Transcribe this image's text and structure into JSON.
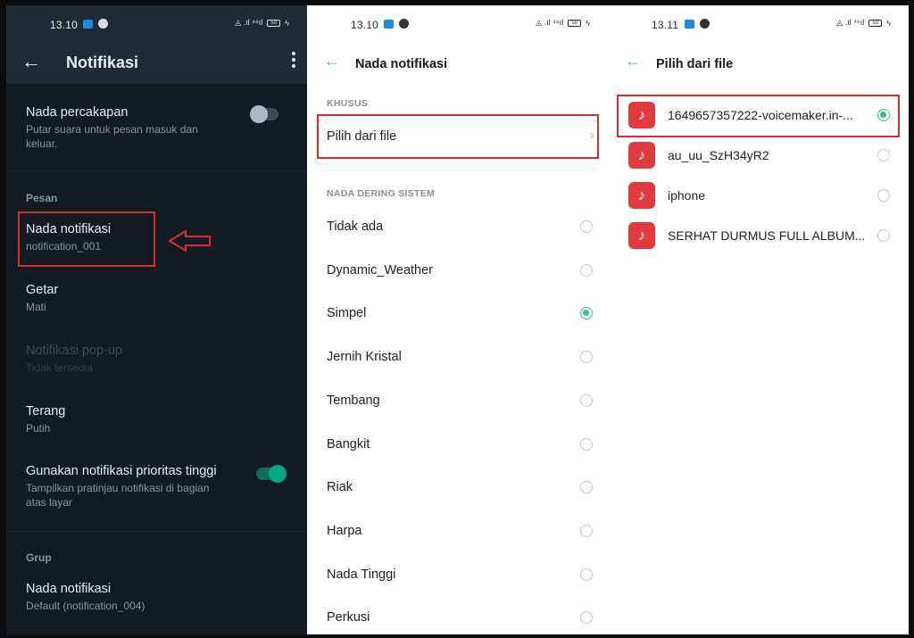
{
  "annotation_color": "#d32f2f",
  "accent": {
    "whatsapp_green": "#00a884",
    "radio_green": "#3bbf8a",
    "file_icon_red": "#e0393e"
  },
  "screens": [
    {
      "theme": "dark",
      "status_bar": {
        "time": "13.10",
        "battery": "50"
      },
      "app_bar": {
        "back_icon": "arrow-left",
        "title": "Notifikasi",
        "menu_icon": "more-vertical"
      },
      "items": [
        {
          "title": "Nada percakapan",
          "subtitle_line1": "Putar suara untuk pesan masuk dan",
          "subtitle_line2": "keluar.",
          "toggle": false
        },
        {
          "section": "Pesan"
        },
        {
          "title": "Nada notifikasi",
          "subtitle": "notification_001",
          "highlighted": true
        },
        {
          "title": "Getar",
          "subtitle": "Mati"
        },
        {
          "title": "Notifikasi pop-up",
          "subtitle": "Tidak tersedia",
          "disabled": true
        },
        {
          "title": "Terang",
          "subtitle": "Putih"
        },
        {
          "title": "Gunakan notifikasi prioritas tinggi",
          "subtitle_line1": "Tampilkan pratinjau notifikasi di bagian",
          "subtitle_line2": "atas layar",
          "toggle": true
        },
        {
          "section": "Grup"
        },
        {
          "title": "Nada notifikasi",
          "subtitle": "Default (notification_004)"
        }
      ]
    },
    {
      "theme": "light",
      "status_bar": {
        "time": "13.10",
        "battery": "50"
      },
      "app_bar": {
        "back_icon": "arrow-left",
        "title": "Nada notifikasi"
      },
      "custom_section": "KHUSUS",
      "choose_file_label": "Pilih dari file",
      "system_section": "NADA DERING SISTEM",
      "ringtones": [
        {
          "name": "Tidak ada",
          "selected": false
        },
        {
          "name": "Dynamic_Weather",
          "selected": false
        },
        {
          "name": "Simpel",
          "selected": true
        },
        {
          "name": "Jernih Kristal",
          "selected": false
        },
        {
          "name": "Tembang",
          "selected": false
        },
        {
          "name": "Bangkit",
          "selected": false
        },
        {
          "name": "Riak",
          "selected": false
        },
        {
          "name": "Harpa",
          "selected": false
        },
        {
          "name": "Nada Tinggi",
          "selected": false
        },
        {
          "name": "Perkusi",
          "selected": false
        }
      ]
    },
    {
      "theme": "light",
      "status_bar": {
        "time": "13.11",
        "battery": "50"
      },
      "app_bar": {
        "back_icon": "arrow-left",
        "title": "Pilih dari file"
      },
      "files": [
        {
          "name": "1649657357222-voicemaker.in-...",
          "selected": true,
          "icon": "music-note"
        },
        {
          "name": "au_uu_SzH34yR2",
          "selected": false,
          "icon": "music-note"
        },
        {
          "name": "iphone",
          "selected": false,
          "icon": "music-note"
        },
        {
          "name": "SERHAT DURMUS FULL ALBUM...",
          "selected": false,
          "icon": "music-note"
        }
      ]
    }
  ],
  "icons": {
    "music_glyph": "♪",
    "back_glyph": "←",
    "chevron_glyph": "›",
    "status_right": "◬ .ıl ⁴⁶ıl"
  }
}
